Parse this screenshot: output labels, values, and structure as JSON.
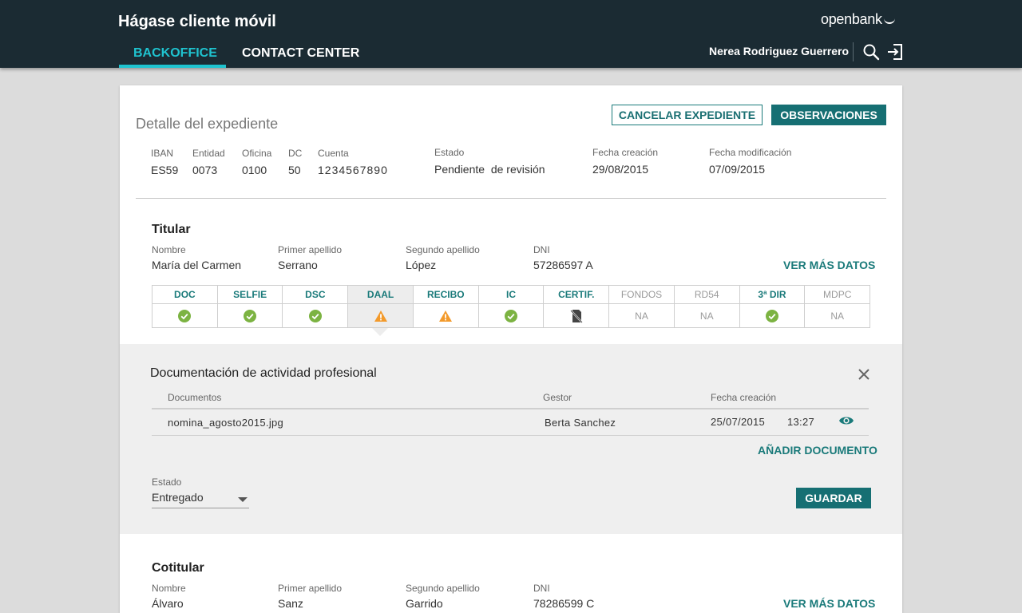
{
  "header": {
    "app_title": "Hágase cliente móvil",
    "brand": "openbank",
    "tabs": [
      {
        "label": "BACKOFFICE",
        "active": true
      },
      {
        "label": "CONTACT CENTER",
        "active": false
      }
    ],
    "user_name": "Nerea Rodriguez Guerrero",
    "icons": [
      "search-icon",
      "logout-icon"
    ]
  },
  "expediente": {
    "title": "Detalle del expediente",
    "cancel_label": "CANCELAR EXPEDIENTE",
    "observations_label": "OBSERVACIONES",
    "fields": {
      "iban": {
        "label": "IBAN",
        "value": "ES59"
      },
      "entidad": {
        "label": "Entidad",
        "value": "0073"
      },
      "oficina": {
        "label": "Oficina",
        "value": "0100"
      },
      "dc": {
        "label": "DC",
        "value": "50"
      },
      "cuenta": {
        "label": "Cuenta",
        "value": "1234567890"
      },
      "estado": {
        "label": "Estado",
        "value": "Pendiente  de revisión"
      },
      "fecha_creacion": {
        "label": "Fecha creación",
        "value": "29/08/2015"
      },
      "fecha_modificacion": {
        "label": "Fecha modificación",
        "value": "07/09/2015"
      }
    }
  },
  "titular": {
    "title": "Titular",
    "nombre": {
      "label": "Nombre",
      "value": "María del Carmen"
    },
    "primer_apellido": {
      "label": "Primer apellido",
      "value": "Serrano"
    },
    "segundo_apellido": {
      "label": "Segundo apellido",
      "value": "López"
    },
    "dni": {
      "label": "DNI",
      "value": "57286597 A"
    },
    "more_link": "VER MÁS DATOS"
  },
  "status_grid": [
    {
      "label": "DOC",
      "status": "ok"
    },
    {
      "label": "SELFIE",
      "status": "ok"
    },
    {
      "label": "DSC",
      "status": "ok"
    },
    {
      "label": "DAAL",
      "status": "warning",
      "active": true
    },
    {
      "label": "RECIBO",
      "status": "warning"
    },
    {
      "label": "IC",
      "status": "ok"
    },
    {
      "label": "CERTIF.",
      "status": "no-doc"
    },
    {
      "label": "FONDOS",
      "status": "na",
      "text": "NA"
    },
    {
      "label": "RD54",
      "status": "na",
      "text": "NA"
    },
    {
      "label": "3ª DIR",
      "status": "ok"
    },
    {
      "label": "MDPC",
      "status": "na",
      "text": "NA"
    }
  ],
  "colors": {
    "ok": "#7cb342",
    "warning": "#f39a2b",
    "accent": "#1a7a7a",
    "header_bg": "#1b2b33",
    "tab_active": "#1fc3cf"
  },
  "detail_panel": {
    "title": "Documentación de actividad profesional",
    "columns": {
      "documentos": "Documentos",
      "gestor": "Gestor",
      "fecha": "Fecha creación"
    },
    "rows": [
      {
        "documento": "nomina_agosto2015.jpg",
        "gestor": "Berta Sanchez",
        "fecha": "25/07/2015",
        "hora": "13:27"
      }
    ],
    "add_link": "AÑADIR DOCUMENTO",
    "estado_label": "Estado",
    "estado_value": "Entregado",
    "save_label": "GUARDAR"
  },
  "cotitular": {
    "title": "Cotitular",
    "nombre": {
      "label": "Nombre",
      "value": "Álvaro"
    },
    "primer_apellido": {
      "label": "Primer apellido",
      "value": "Sanz"
    },
    "segundo_apellido": {
      "label": "Segundo apellido",
      "value": "Garrido"
    },
    "dni": {
      "label": "DNI",
      "value": "78286599 C"
    },
    "more_link": "VER MÁS DATOS"
  }
}
